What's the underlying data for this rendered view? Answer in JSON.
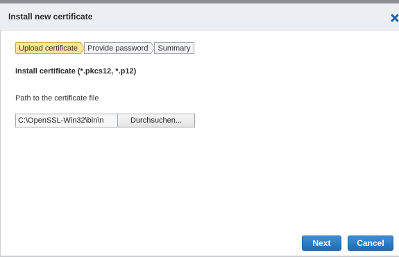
{
  "dialog": {
    "title": "Install new certificate",
    "close_icon": "close-x-icon"
  },
  "wizard": {
    "steps": [
      {
        "label": "Upload certificate",
        "state": "active"
      },
      {
        "label": "Provide password",
        "state": "inactive"
      },
      {
        "label": "Summary",
        "state": "inactive"
      }
    ]
  },
  "form": {
    "section_title": "Install certificate (*.pkcs12, *.p12)",
    "path_label": "Path to the certificate file",
    "path_value": "C:\\OpenSSL-Win32\\bin\\n",
    "browse_label": "Durchsuchen..."
  },
  "footer": {
    "next_label": "Next",
    "cancel_label": "Cancel"
  },
  "colors": {
    "active_step": "#fce49a",
    "primary_button": "#2a7bc7",
    "close_icon": "#1f5fa8"
  }
}
